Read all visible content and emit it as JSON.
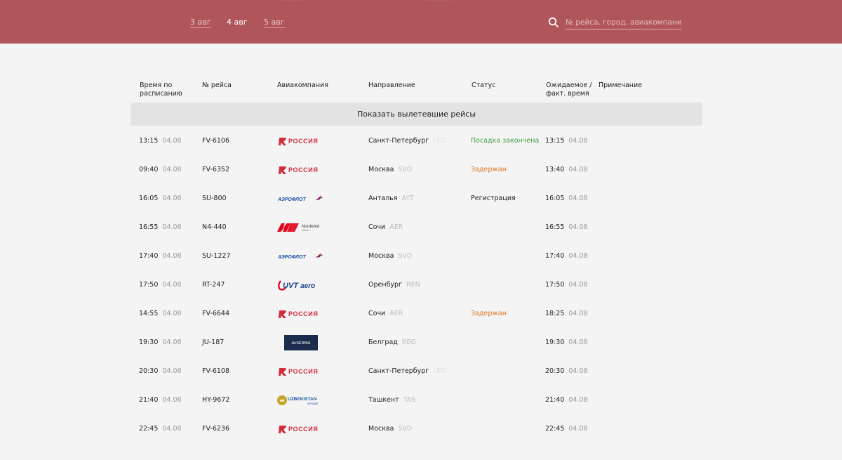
{
  "header": {
    "dates": [
      {
        "label": "3 авг",
        "active": false
      },
      {
        "label": "4 авг",
        "active": true
      },
      {
        "label": "5 авг",
        "active": false
      }
    ],
    "search_placeholder": "№ рейса, город, авиакомпания",
    "colors": {
      "brand": "#b0565b"
    }
  },
  "table": {
    "columns": {
      "scheduled": "Время по расписанию",
      "flight": "№ рейса",
      "airline": "Авиакомпания",
      "destination": "Направление",
      "status": "Статус",
      "expected": "Ожидаемое / факт. время",
      "note": "Примечание"
    },
    "show_departed_label": "Показать вылетевшие рейсы",
    "rows": [
      {
        "time": "13:15",
        "date": "04.08",
        "flight": "FV-6106",
        "airline_logo": "rossiya-logo",
        "city": "Санкт-Петербург",
        "code": "LED",
        "status": "Посадка закончена",
        "status_type": "ok",
        "exp_time": "13:15",
        "exp_date": "04.08"
      },
      {
        "time": "09:40",
        "date": "04.08",
        "flight": "FV-6352",
        "airline_logo": "rossiya-logo",
        "city": "Москва",
        "code": "SVO",
        "status": "Задержан",
        "status_type": "delay",
        "exp_time": "13:40",
        "exp_date": "04.08"
      },
      {
        "time": "16:05",
        "date": "04.08",
        "flight": "SU-800",
        "airline_logo": "aeroflot-logo",
        "city": "Анталья",
        "code": "AYT",
        "status": "Регистрация",
        "status_type": "normal",
        "exp_time": "16:05",
        "exp_date": "04.08"
      },
      {
        "time": "16:55",
        "date": "04.08",
        "flight": "N4-440",
        "airline_logo": "nordwind-logo",
        "city": "Сочи",
        "code": "AER",
        "status": "",
        "status_type": "normal",
        "exp_time": "16:55",
        "exp_date": "04.08"
      },
      {
        "time": "17:40",
        "date": "04.08",
        "flight": "SU-1227",
        "airline_logo": "aeroflot-logo",
        "city": "Москва",
        "code": "SVO",
        "status": "",
        "status_type": "normal",
        "exp_time": "17:40",
        "exp_date": "04.08"
      },
      {
        "time": "17:50",
        "date": "04.08",
        "flight": "RT-247",
        "airline_logo": "uvtaero-logo",
        "city": "Оренбург",
        "code": "REN",
        "status": "",
        "status_type": "normal",
        "exp_time": "17:50",
        "exp_date": "04.08"
      },
      {
        "time": "14:55",
        "date": "04.08",
        "flight": "FV-6644",
        "airline_logo": "rossiya-logo",
        "city": "Сочи",
        "code": "AER",
        "status": "Задержан",
        "status_type": "delay",
        "exp_time": "18:25",
        "exp_date": "04.08"
      },
      {
        "time": "19:30",
        "date": "04.08",
        "flight": "JU-187",
        "airline_logo": "airserbia-logo",
        "city": "Белград",
        "code": "BEG",
        "status": "",
        "status_type": "normal",
        "exp_time": "19:30",
        "exp_date": "04.08"
      },
      {
        "time": "20:30",
        "date": "04.08",
        "flight": "FV-6108",
        "airline_logo": "rossiya-logo",
        "city": "Санкт-Петербург",
        "code": "LED",
        "status": "",
        "status_type": "normal",
        "exp_time": "20:30",
        "exp_date": "04.08"
      },
      {
        "time": "21:40",
        "date": "04.08",
        "flight": "HY-9672",
        "airline_logo": "uzbekistan-logo",
        "city": "Ташкент",
        "code": "TAS",
        "status": "",
        "status_type": "normal",
        "exp_time": "21:40",
        "exp_date": "04.08"
      },
      {
        "time": "22:45",
        "date": "04.08",
        "flight": "FV-6236",
        "airline_logo": "rossiya-logo",
        "city": "Москва",
        "code": "SVO",
        "status": "",
        "status_type": "normal",
        "exp_time": "22:45",
        "exp_date": "04.08"
      }
    ]
  },
  "logos": {
    "rossiya-logo": {
      "text": "РОССИЯ",
      "color": "#d22b3a"
    },
    "aeroflot-logo": {
      "text": "АЭРОФЛОТ",
      "color": "#1e4fa3"
    },
    "nordwind-logo": {
      "text": "Nordwind",
      "sub": "airlines",
      "color": "#e2001a"
    },
    "uvtaero-logo": {
      "text": "UVTaero",
      "color": "#1c3f8c",
      "accent": "#e2001a"
    },
    "airserbia-logo": {
      "text": "AirSERBIA",
      "color": "#1b2b4e"
    },
    "uzbekistan-logo": {
      "text": "UZBEKISTAN",
      "sub": "airways",
      "color": "#1d5aa5",
      "accent": "#c8a32a"
    }
  }
}
